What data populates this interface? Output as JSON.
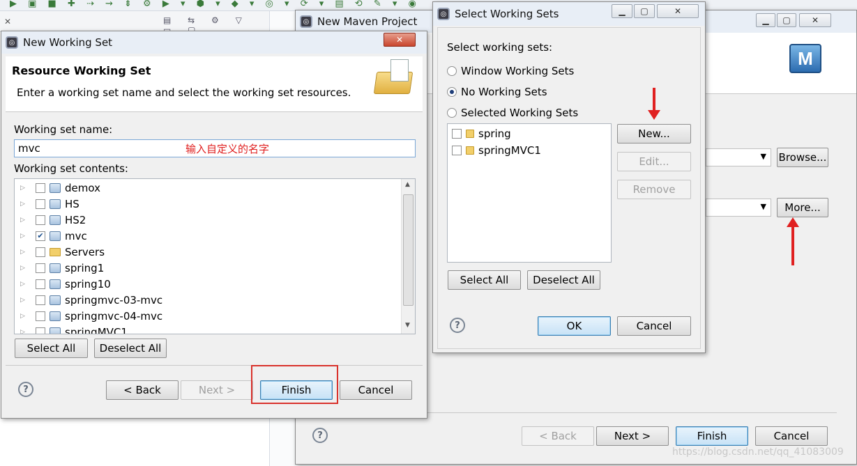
{
  "ide": {
    "toolbar_glyphs": "▶ ▣ ■ ✚ ⇢ ⇝ ⇟ ⚙ ▶ ▾ ⬢ ▾ ◆ ▾ ◎ ▾ ⟳ ▾ ▤ ⟲ ✎ ▾ ◉"
  },
  "maven": {
    "title": "New Maven Project",
    "browse_label": "Browse...",
    "more_label": "More...",
    "back_label": "< Back",
    "next_label": "Next >",
    "finish_label": "Finish",
    "cancel_label": "Cancel",
    "help": "?"
  },
  "nws": {
    "title": "New Working Set",
    "header_title": "Resource Working Set",
    "header_desc": "Enter a working set name and select the working set resources.",
    "name_label": "Working set name:",
    "name_value": "mvc",
    "annotation": "输入自定义的名字",
    "contents_label": "Working set contents:",
    "items": [
      {
        "label": "demox",
        "checked": false,
        "type": "project"
      },
      {
        "label": "HS",
        "checked": false,
        "type": "project"
      },
      {
        "label": "HS2",
        "checked": false,
        "type": "project"
      },
      {
        "label": "mvc",
        "checked": true,
        "type": "project"
      },
      {
        "label": "Servers",
        "checked": false,
        "type": "folder"
      },
      {
        "label": "spring1",
        "checked": false,
        "type": "project"
      },
      {
        "label": "spring10",
        "checked": false,
        "type": "project"
      },
      {
        "label": "springmvc-03-mvc",
        "checked": false,
        "type": "project"
      },
      {
        "label": "springmvc-04-mvc",
        "checked": false,
        "type": "project"
      },
      {
        "label": "springMVC1",
        "checked": false,
        "type": "project"
      }
    ],
    "select_all_label": "Select All",
    "deselect_all_label": "Deselect All",
    "back_label": "< Back",
    "next_label": "Next >",
    "finish_label": "Finish",
    "cancel_label": "Cancel",
    "help": "?"
  },
  "sws": {
    "title": "Select Working Sets",
    "prompt": "Select working sets:",
    "options": [
      {
        "label": "Window Working Sets",
        "selected": false
      },
      {
        "label": "No Working Sets",
        "selected": true
      },
      {
        "label": "Selected Working Sets",
        "selected": false
      }
    ],
    "sets": [
      {
        "label": "spring",
        "checked": false
      },
      {
        "label": "springMVC1",
        "checked": false
      }
    ],
    "new_label": "New...",
    "edit_label": "Edit...",
    "remove_label": "Remove",
    "select_all_label": "Select All",
    "deselect_all_label": "Deselect All",
    "ok_label": "OK",
    "cancel_label": "Cancel",
    "help": "?"
  },
  "watermark": "https://blog.csdn.net/qq_41083009",
  "colors": {
    "annotation_red": "#e02020",
    "highlight_red": "#d9312b"
  }
}
